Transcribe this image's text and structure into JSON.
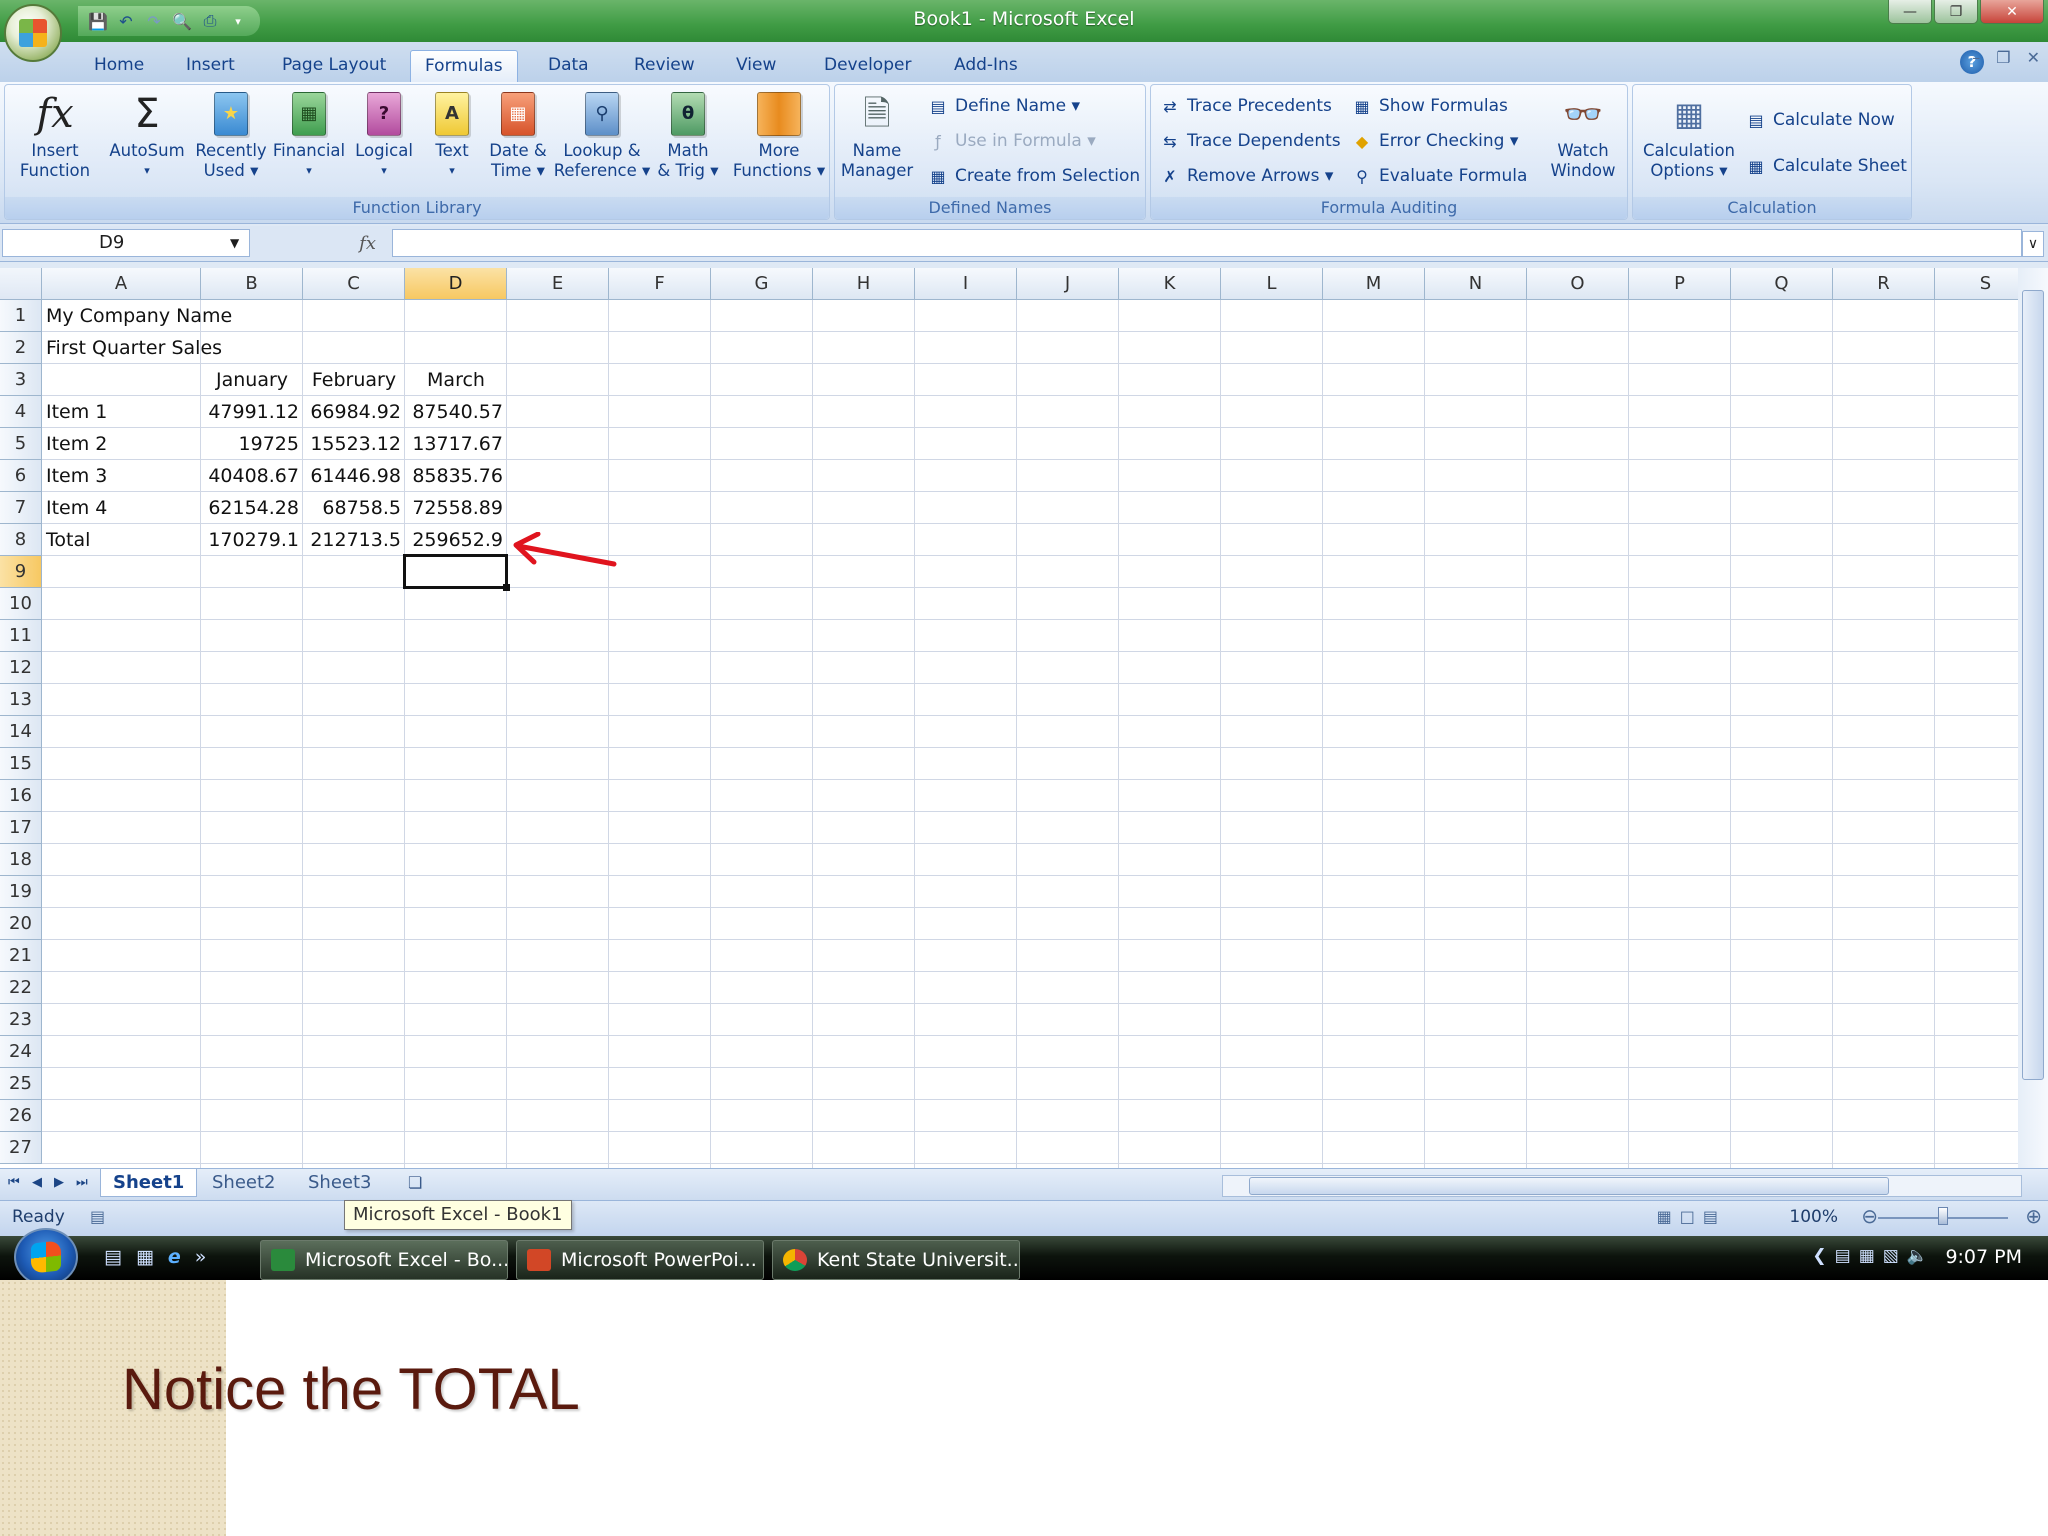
{
  "window": {
    "title": "Book1 - Microsoft Excel"
  },
  "tabs": [
    "Home",
    "Insert",
    "Page Layout",
    "Formulas",
    "Data",
    "Review",
    "View",
    "Developer",
    "Add-Ins"
  ],
  "active_tab": "Formulas",
  "ribbon": {
    "function_library": {
      "label": "Function Library",
      "buttons": [
        {
          "line1": "Insert",
          "line2": "Function"
        },
        {
          "line1": "AutoSum",
          "line2": "▾"
        },
        {
          "line1": "Recently",
          "line2": "Used ▾"
        },
        {
          "line1": "Financial",
          "line2": "▾"
        },
        {
          "line1": "Logical",
          "line2": "▾"
        },
        {
          "line1": "Text",
          "line2": "▾"
        },
        {
          "line1": "Date &",
          "line2": "Time ▾"
        },
        {
          "line1": "Lookup &",
          "line2": "Reference ▾"
        },
        {
          "line1": "Math",
          "line2": "& Trig ▾"
        },
        {
          "line1": "More",
          "line2": "Functions ▾"
        }
      ]
    },
    "defined_names": {
      "label": "Defined Names",
      "name_manager": {
        "line1": "Name",
        "line2": "Manager"
      },
      "define_name": "Define Name ▾",
      "use_in_formula": "Use in Formula ▾",
      "create_from_selection": "Create from Selection"
    },
    "formula_auditing": {
      "label": "Formula Auditing",
      "trace_precedents": "Trace Precedents",
      "trace_dependents": "Trace Dependents",
      "remove_arrows": "Remove Arrows ▾",
      "show_formulas": "Show Formulas",
      "error_checking": "Error Checking ▾",
      "evaluate_formula": "Evaluate Formula",
      "watch_window": {
        "line1": "Watch",
        "line2": "Window"
      }
    },
    "calculation": {
      "label": "Calculation",
      "options": {
        "line1": "Calculation",
        "line2": "Options ▾"
      },
      "calculate_now": "Calculate Now",
      "calculate_sheet": "Calculate Sheet"
    }
  },
  "formula_bar": {
    "name_box": "D9",
    "fx": "fx",
    "formula": ""
  },
  "columns": [
    "A",
    "B",
    "C",
    "D",
    "E",
    "F",
    "G",
    "H",
    "I",
    "J",
    "K",
    "L",
    "M",
    "N",
    "O",
    "P",
    "Q",
    "R",
    "S"
  ],
  "selected_column": "D",
  "selected_row": 9,
  "rows": [
    "1",
    "2",
    "3",
    "4",
    "5",
    "6",
    "7",
    "8",
    "9",
    "10",
    "11",
    "12",
    "13",
    "14",
    "15",
    "16",
    "17",
    "18",
    "19",
    "20",
    "21",
    "22",
    "23",
    "24",
    "25",
    "26",
    "27"
  ],
  "cells": {
    "A1": "My Company Name",
    "A2": "First Quarter Sales",
    "B3": "January",
    "C3": "February",
    "D3": "March",
    "A4": "Item 1",
    "B4": "47991.12",
    "C4": "66984.92",
    "D4": "87540.57",
    "A5": "Item 2",
    "B5": "19725",
    "C5": "15523.12",
    "D5": "13717.67",
    "A6": "Item 3",
    "B6": "40408.67",
    "C6": "61446.98",
    "D6": "85835.76",
    "A7": "Item 4",
    "B7": "62154.28",
    "C7": "68758.5",
    "D7": "72558.89",
    "A8": "Total",
    "B8": "170279.1",
    "C8": "212713.5",
    "D8": "259652.9"
  },
  "sheets": [
    "Sheet1",
    "Sheet2",
    "Sheet3"
  ],
  "active_sheet": "Sheet1",
  "status": {
    "ready": "Ready",
    "zoom": "100%"
  },
  "tooltip": "Microsoft Excel - Book1",
  "taskbar": {
    "tasks": [
      "Microsoft Excel - Bo...",
      "Microsoft PowerPoi...",
      "Kent State Universit..."
    ],
    "clock": "9:07 PM"
  },
  "caption": "Notice the TOTAL",
  "colors": {
    "arrow": "#e0141e",
    "caption": "#5a1a0e",
    "titlebar": "#3f9b44"
  }
}
